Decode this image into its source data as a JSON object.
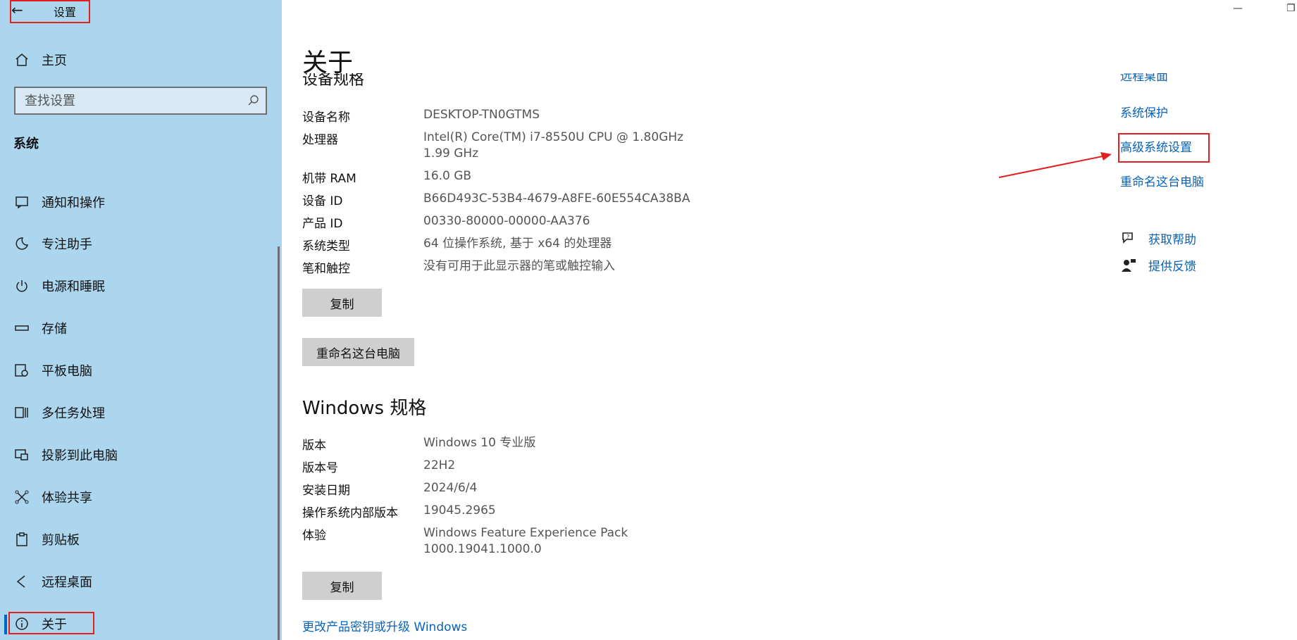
{
  "titlebar": {
    "back_icon": "←",
    "app_title": "设置",
    "minimize_icon": "—",
    "restore_icon": "❐"
  },
  "sidebar": {
    "home": "主页",
    "search_placeholder": "查找设置",
    "section": "系统",
    "items": [
      {
        "label": "通知和操作",
        "icon": "notification-icon"
      },
      {
        "label": "专注助手",
        "icon": "moon-icon"
      },
      {
        "label": "电源和睡眠",
        "icon": "power-icon"
      },
      {
        "label": "存储",
        "icon": "storage-icon"
      },
      {
        "label": "平板电脑",
        "icon": "tablet-icon"
      },
      {
        "label": "多任务处理",
        "icon": "multitask-icon"
      },
      {
        "label": "投影到此电脑",
        "icon": "project-icon"
      },
      {
        "label": "体验共享",
        "icon": "share-icon"
      },
      {
        "label": "剪贴板",
        "icon": "clipboard-icon"
      },
      {
        "label": "远程桌面",
        "icon": "remote-icon"
      },
      {
        "label": "关于",
        "icon": "info-icon",
        "active": true
      }
    ]
  },
  "main": {
    "title": "关于",
    "device_specs_heading_partial": "设备规格",
    "device_specs": [
      {
        "key": "设备名称",
        "value": "DESKTOP-TN0GTMS"
      },
      {
        "key": "处理器",
        "value": "Intel(R) Core(TM) i7-8550U CPU @ 1.80GHz   1.99 GHz"
      },
      {
        "key": "机带 RAM",
        "value": "16.0 GB"
      },
      {
        "key": "设备 ID",
        "value": "B66D493C-53B4-4679-A8FE-60E554CA38BA"
      },
      {
        "key": "产品 ID",
        "value": "00330-80000-00000-AA376"
      },
      {
        "key": "系统类型",
        "value": "64 位操作系统, 基于 x64 的处理器"
      },
      {
        "key": "笔和触控",
        "value": "没有可用于此显示器的笔或触控输入"
      }
    ],
    "copy_button": "复制",
    "rename_button": "重命名这台电脑",
    "windows_specs_heading": "Windows 规格",
    "windows_specs": [
      {
        "key": "版本",
        "value": "Windows 10 专业版"
      },
      {
        "key": "版本号",
        "value": "22H2"
      },
      {
        "key": "安装日期",
        "value": "2024/6/4"
      },
      {
        "key": "操作系统内部版本",
        "value": "19045.2965"
      },
      {
        "key": "体验",
        "value": "Windows Feature Experience Pack 1000.19041.1000.0"
      }
    ],
    "copy_button_2": "复制",
    "change_key_link": "更改产品密钥或升级 Windows"
  },
  "related": {
    "partial_link": "远程桌面",
    "system_protection": "系统保护",
    "advanced_settings": "高级系统设置",
    "rename_pc": "重命名这台电脑",
    "get_help": "获取帮助",
    "feedback": "提供反馈"
  },
  "annotation": {
    "color": "#e32020"
  }
}
